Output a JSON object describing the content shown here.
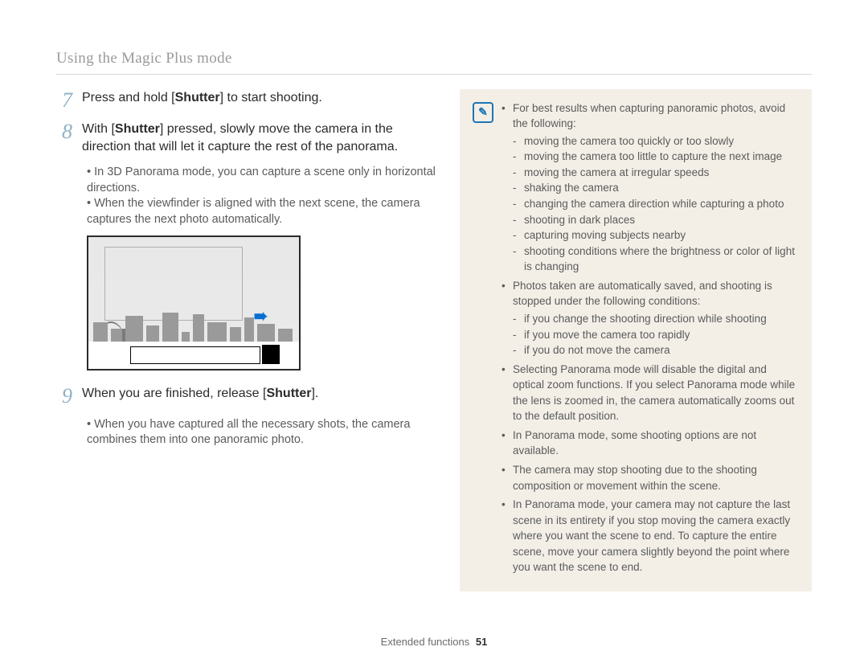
{
  "header": {
    "section_title": "Using the Magic Plus mode"
  },
  "steps": {
    "s7": {
      "num": "7",
      "text_before": "Press and hold [",
      "bold": "Shutter",
      "text_after": "] to start shooting."
    },
    "s8": {
      "num": "8",
      "line1_before": "With [",
      "line1_bold": "Shutter",
      "line1_after": "] pressed, slowly move the camera in the direction that will let it capture the rest of the panorama.",
      "bullets": [
        "In 3D Panorama mode, you can capture a scene only in horizontal directions.",
        "When the viewfinder is aligned with the next scene, the camera captures the next photo automatically."
      ]
    },
    "s9": {
      "num": "9",
      "text_before": "When you are finished, release [",
      "bold": "Shutter",
      "text_after": "].",
      "bullets": [
        "When you have captured all the necessary shots, the camera combines them into one panoramic photo."
      ]
    }
  },
  "notes": {
    "intro1": "For best results when capturing panoramic photos, avoid the following:",
    "avoid": [
      "moving the camera too quickly or too slowly",
      "moving the camera too little to capture the next image",
      "moving the camera at irregular speeds",
      "shaking the camera",
      "changing the camera direction while capturing a photo",
      "shooting in dark places",
      "capturing moving subjects nearby",
      "shooting conditions where the brightness or color of light is changing"
    ],
    "intro2": "Photos taken are automatically saved, and shooting is stopped under the following conditions:",
    "stopped": [
      "if you change the shooting direction while shooting",
      "if you move the camera too rapidly",
      "if you do not move the camera"
    ],
    "bul3": "Selecting Panorama mode will disable the digital and optical zoom functions. If you select Panorama mode while the lens is zoomed in, the camera automatically zooms out to the default position.",
    "bul4": "In Panorama mode, some shooting options are not available.",
    "bul5": "The camera may stop shooting due to the shooting composition or movement within the scene.",
    "bul6": "In Panorama mode, your camera may not capture the last scene in its entirety if you stop moving the camera exactly where you want the scene to end. To capture the entire scene, move your camera slightly beyond the point where you want the scene to end."
  },
  "footer": {
    "label": "Extended functions",
    "page": "51"
  },
  "icons": {
    "note": "✎",
    "arrow": "➠"
  }
}
